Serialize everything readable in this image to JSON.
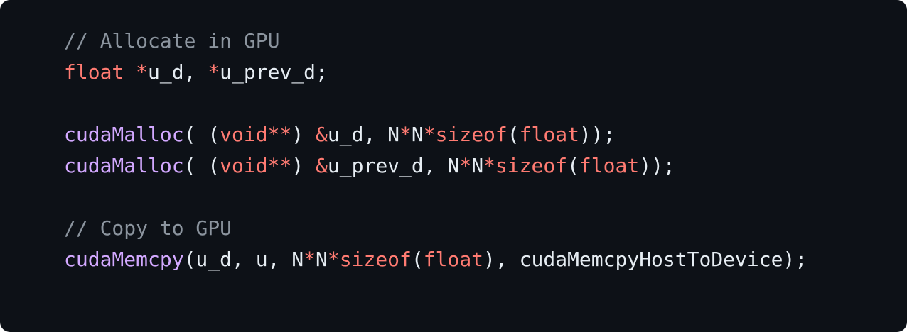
{
  "colors": {
    "background": "#0d1117",
    "plain": "#e6edf3",
    "comment": "#8b949e",
    "keyword": "#ff7b72",
    "function": "#d2a8ff"
  },
  "code": {
    "lines": [
      [
        {
          "t": "comment",
          "text": "// Allocate in GPU"
        }
      ],
      [
        {
          "t": "keyword",
          "text": "float"
        },
        {
          "t": "plain",
          "text": " "
        },
        {
          "t": "keyword",
          "text": "*"
        },
        {
          "t": "plain",
          "text": "u_d, "
        },
        {
          "t": "keyword",
          "text": "*"
        },
        {
          "t": "plain",
          "text": "u_prev_d;"
        }
      ],
      [],
      [
        {
          "t": "func",
          "text": "cudaMalloc"
        },
        {
          "t": "plain",
          "text": "( ("
        },
        {
          "t": "keyword",
          "text": "void**"
        },
        {
          "t": "plain",
          "text": ") "
        },
        {
          "t": "keyword",
          "text": "&"
        },
        {
          "t": "plain",
          "text": "u_d, N"
        },
        {
          "t": "keyword",
          "text": "*"
        },
        {
          "t": "plain",
          "text": "N"
        },
        {
          "t": "keyword",
          "text": "*sizeof"
        },
        {
          "t": "plain",
          "text": "("
        },
        {
          "t": "keyword",
          "text": "float"
        },
        {
          "t": "plain",
          "text": "));"
        }
      ],
      [
        {
          "t": "func",
          "text": "cudaMalloc"
        },
        {
          "t": "plain",
          "text": "( ("
        },
        {
          "t": "keyword",
          "text": "void**"
        },
        {
          "t": "plain",
          "text": ") "
        },
        {
          "t": "keyword",
          "text": "&"
        },
        {
          "t": "plain",
          "text": "u_prev_d, N"
        },
        {
          "t": "keyword",
          "text": "*"
        },
        {
          "t": "plain",
          "text": "N"
        },
        {
          "t": "keyword",
          "text": "*sizeof"
        },
        {
          "t": "plain",
          "text": "("
        },
        {
          "t": "keyword",
          "text": "float"
        },
        {
          "t": "plain",
          "text": "));"
        }
      ],
      [],
      [
        {
          "t": "comment",
          "text": "// Copy to GPU"
        }
      ],
      [
        {
          "t": "func",
          "text": "cudaMemcpy"
        },
        {
          "t": "plain",
          "text": "(u_d, u, N"
        },
        {
          "t": "keyword",
          "text": "*"
        },
        {
          "t": "plain",
          "text": "N"
        },
        {
          "t": "keyword",
          "text": "*sizeof"
        },
        {
          "t": "plain",
          "text": "("
        },
        {
          "t": "keyword",
          "text": "float"
        },
        {
          "t": "plain",
          "text": "), cudaMemcpyHostToDevice);"
        }
      ]
    ]
  }
}
